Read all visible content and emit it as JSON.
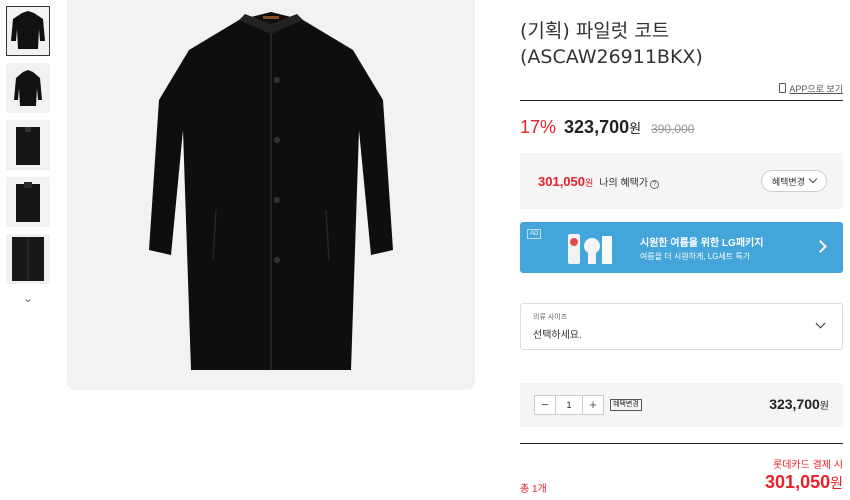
{
  "product": {
    "title_line1": "(기획) 파일럿 코트",
    "title_line2": "(ASCAW26911BKX)",
    "app_link": "APP으로 보기"
  },
  "pricing": {
    "discount": "17%",
    "price": "323,700",
    "won": "원",
    "original_price": "390,000"
  },
  "benefit": {
    "price": "301,050",
    "won": "원",
    "label": "나의 혜택가",
    "info_icon": "info-icon",
    "button_label": "혜택변경"
  },
  "ad": {
    "tag": "AD",
    "title": "시원한 여름을 위한 LG패키지",
    "subtitle": "여름을 더 시원하게, LG세트 특가"
  },
  "option": {
    "label": "의류 사이즈",
    "value": "선택하세요."
  },
  "quantity": {
    "minus": "−",
    "value": "1",
    "plus": "+",
    "benefit_tag": "혜택변경",
    "price": "323,700",
    "won": "원"
  },
  "total": {
    "card_note": "롯데카드 결제 시",
    "count": "총 1개",
    "price": "301,050",
    "won": "원"
  },
  "thumbnails": {
    "down_icon": "chevron-down-icon",
    "count": 5
  },
  "colors": {
    "accent_red": "#e8202a",
    "ad_blue": "#44a5da",
    "gray_bg": "#f2f2f2"
  }
}
